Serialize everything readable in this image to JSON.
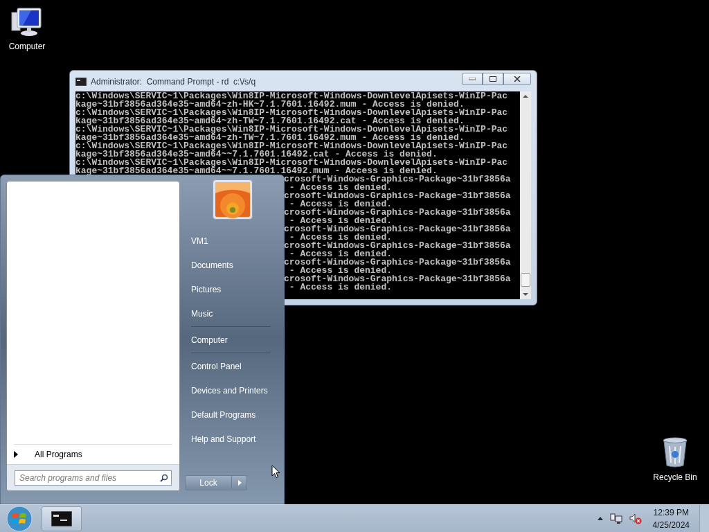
{
  "desktop_icons": [
    {
      "label": "Computer",
      "kind": "computer"
    },
    {
      "label": "Recycle Bin",
      "kind": "recycle"
    }
  ],
  "console": {
    "title": "Administrator:  Command Prompt - rd  c:\\/s/q",
    "lines": [
      {
        "kind": "full",
        "text": "c:\\Windows\\SERVIC~1\\Packages\\Win8IP-Microsoft-Windows-DownlevelApisets-WinIP-Pac"
      },
      {
        "kind": "full",
        "text": "kage~31bf3856ad364e35~amd64~zh-HK~7.1.7601.16492.mum - Access is denied."
      },
      {
        "kind": "full",
        "text": "c:\\Windows\\SERVIC~1\\Packages\\Win8IP-Microsoft-Windows-DownlevelApisets-WinIP-Pac"
      },
      {
        "kind": "full",
        "text": "kage~31bf3856ad364e35~amd64~zh-TW~7.1.7601.16492.cat - Access is denied."
      },
      {
        "kind": "full",
        "text": "c:\\Windows\\SERVIC~1\\Packages\\Win8IP-Microsoft-Windows-DownlevelApisets-WinIP-Pac"
      },
      {
        "kind": "full",
        "text": "kage~31bf3856ad364e35~amd64~zh-TW~7.1.7601.16492.mum - Access is denied."
      },
      {
        "kind": "full",
        "text": "c:\\Windows\\SERVIC~1\\Packages\\Win8IP-Microsoft-Windows-DownlevelApisets-WinIP-Pac"
      },
      {
        "kind": "full",
        "text": "kage~31bf3856ad364e35~amd64~~7.1.7601.16492.cat - Access is denied."
      },
      {
        "kind": "full",
        "text": "c:\\Windows\\SERVIC~1\\Packages\\Win8IP-Microsoft-Windows-DownlevelApisets-WinIP-Pac"
      },
      {
        "kind": "full",
        "text": "kage~31bf3856ad364e35~amd64~~7.1.7601.16492.mum - Access is denied."
      },
      {
        "kind": "clipped",
        "text": "crosoft-Windows-Graphics-Package~31bf3856a"
      },
      {
        "kind": "clipped",
        "text": " - Access is denied."
      },
      {
        "kind": "clipped",
        "text": "crosoft-Windows-Graphics-Package~31bf3856a"
      },
      {
        "kind": "clipped",
        "text": " - Access is denied."
      },
      {
        "kind": "clipped",
        "text": "crosoft-Windows-Graphics-Package~31bf3856a"
      },
      {
        "kind": "clipped",
        "text": " - Access is denied."
      },
      {
        "kind": "clipped",
        "text": "crosoft-Windows-Graphics-Package~31bf3856a"
      },
      {
        "kind": "clipped",
        "text": " - Access is denied."
      },
      {
        "kind": "clipped",
        "text": "crosoft-Windows-Graphics-Package~31bf3856a"
      },
      {
        "kind": "clipped",
        "text": " - Access is denied."
      },
      {
        "kind": "clipped",
        "text": "crosoft-Windows-Graphics-Package~31bf3856a"
      },
      {
        "kind": "clipped",
        "text": " - Access is denied."
      },
      {
        "kind": "clipped",
        "text": "crosoft-Windows-Graphics-Package~31bf3856a"
      },
      {
        "kind": "clipped",
        "text": " - Access is denied."
      }
    ]
  },
  "start_menu": {
    "right_groups": [
      [
        "VM1",
        "Documents",
        "Pictures",
        "Music"
      ],
      [
        "Computer"
      ],
      [
        "Control Panel",
        "Devices and Printers",
        "Default Programs",
        "Help and Support"
      ]
    ],
    "all_programs": "All Programs",
    "search": {
      "placeholder": "Search programs and files"
    },
    "shutdown_button": "Lock"
  },
  "taskbar": {
    "time": "12:39 PM",
    "date": "4/25/2024"
  }
}
